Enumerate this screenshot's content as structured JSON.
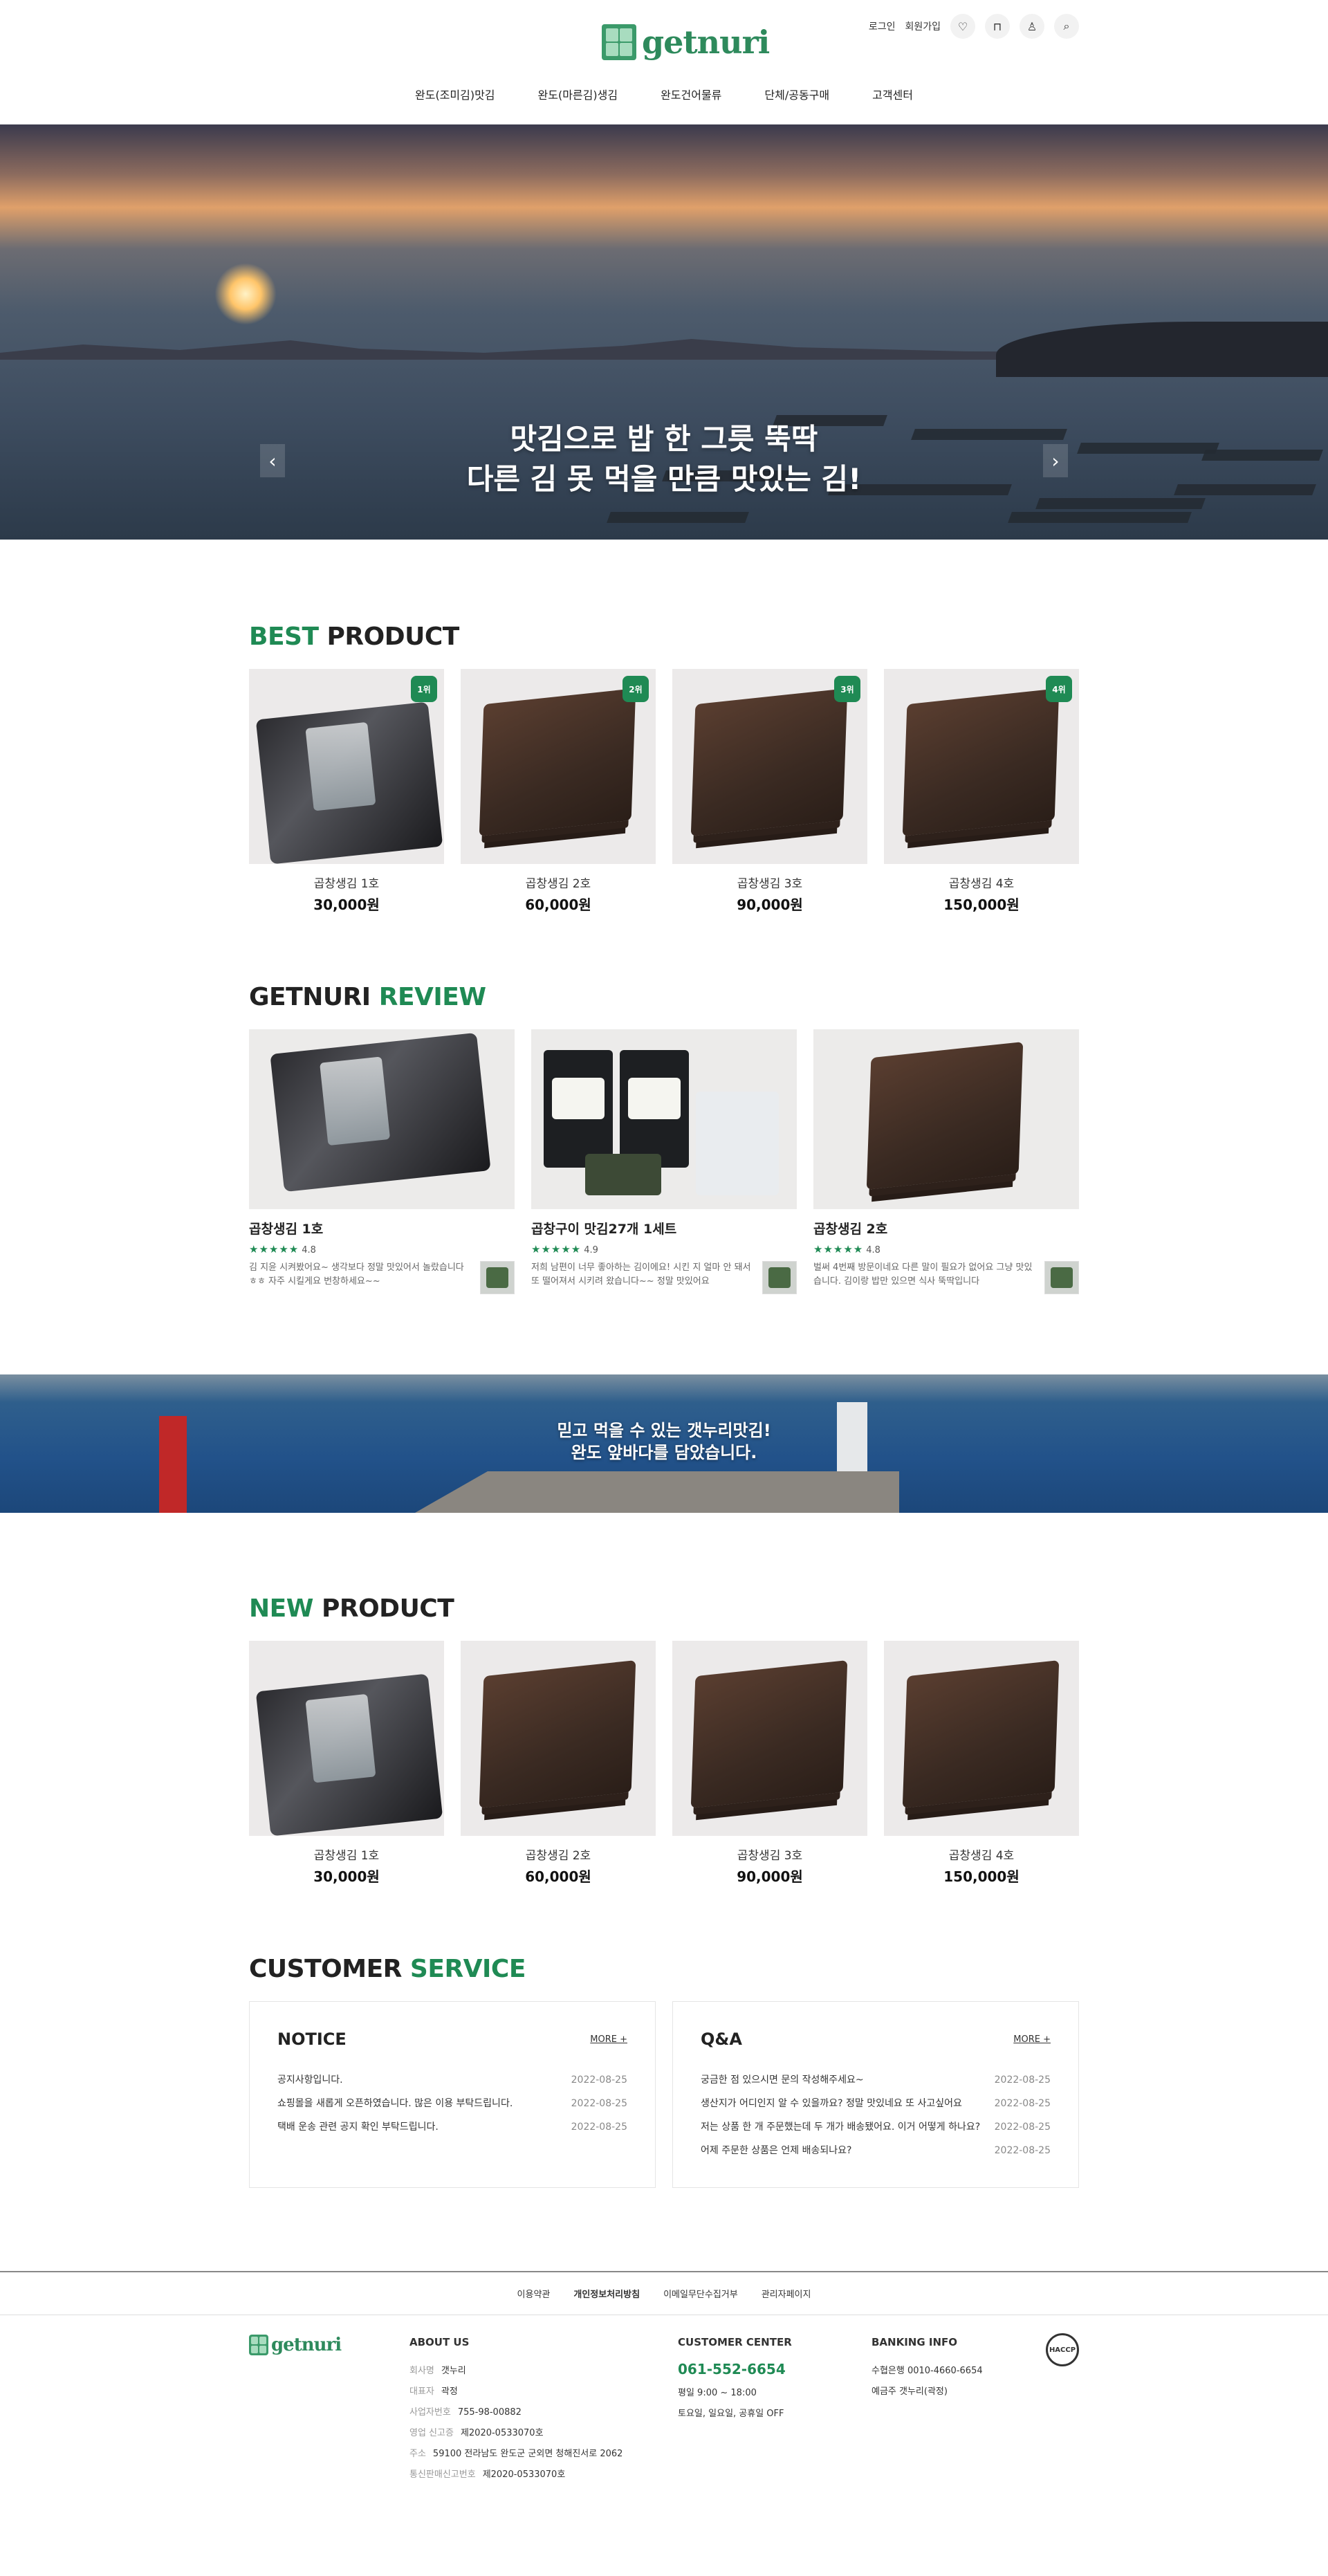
{
  "header": {
    "logo_text": "getnuri",
    "util": {
      "login": "로그인",
      "join": "회원가입"
    },
    "nav": [
      "완도(조미김)맛김",
      "완도(마른김)생김",
      "완도건어물류",
      "단체/공동구매",
      "고객센터"
    ]
  },
  "hero": {
    "line1": "맛김으로 밥 한 그릇 뚝딱",
    "line2": "다른 김 못 먹을 만큼 맛있는 김!",
    "prev": "‹",
    "next": "›"
  },
  "best": {
    "title_accent": "BEST",
    "title_rest": " PRODUCT",
    "items": [
      {
        "rank": "1위",
        "name": "곱창생김 1호",
        "price": "30,000원"
      },
      {
        "rank": "2위",
        "name": "곱창생김 2호",
        "price": "60,000원"
      },
      {
        "rank": "3위",
        "name": "곱창생김 3호",
        "price": "90,000원"
      },
      {
        "rank": "4위",
        "name": "곱창생김 4호",
        "price": "150,000원"
      }
    ]
  },
  "review": {
    "title_rest": "GETNURI ",
    "title_accent": "REVIEW",
    "items": [
      {
        "name": "곱창생김 1호",
        "stars": "★★★★★",
        "score": "4.8",
        "text": "김 지윤 시켜봤어요~ 생각보다 정말 맛있어서 놀랐습니다 ㅎㅎ 자주 시킬게요 번창하세요~~"
      },
      {
        "name": "곱창구이 맛김27개 1세트",
        "stars": "★★★★★",
        "score": "4.9",
        "text": "저희 남편이 너무 좋아하는 김이에요! 시킨 지 얼마 안 돼서 또 떨어져서 시키려 왔습니다~~ 정말 맛있어요"
      },
      {
        "name": "곱창생김 2호",
        "stars": "★★★★★",
        "score": "4.8",
        "text": "벌써 4번째 방문이네요 다른 말이 필요가 없어요 그냥 맛있습니다. 김이랑 밥만 있으면 식사 뚝딱입니다"
      }
    ]
  },
  "banner": {
    "line1": "믿고 먹을 수 있는 갯누리맛김!",
    "line2": "완도 앞바다를 담았습니다."
  },
  "new": {
    "title_accent": "NEW",
    "title_rest": " PRODUCT",
    "items": [
      {
        "name": "곱창생김 1호",
        "price": "30,000원"
      },
      {
        "name": "곱창생김 2호",
        "price": "60,000원"
      },
      {
        "name": "곱창생김 3호",
        "price": "90,000원"
      },
      {
        "name": "곱창생김 4호",
        "price": "150,000원"
      }
    ]
  },
  "cs": {
    "title_rest": "CUSTOMER ",
    "title_accent": "SERVICE",
    "notice": {
      "title": "NOTICE",
      "more": "MORE +",
      "rows": [
        {
          "t": "공지사항입니다.",
          "d": "2022-08-25"
        },
        {
          "t": "쇼핑몰을 새롭게 오픈하였습니다. 많은 이용 부탁드립니다.",
          "d": "2022-08-25"
        },
        {
          "t": "택배 운송 관련 공지 확인 부탁드립니다.",
          "d": "2022-08-25"
        }
      ]
    },
    "qna": {
      "title": "Q&A",
      "more": "MORE +",
      "rows": [
        {
          "t": "궁금한 점 있으시면 문의 작성해주세요~",
          "d": "2022-08-25"
        },
        {
          "t": "생산지가 어디인지 알 수 있을까요? 정말 맛있네요 또 사고싶어요",
          "d": "2022-08-25"
        },
        {
          "t": "저는 상품 한 개 주문했는데 두 개가 배송됐어요. 이거 어떻게 하나요?",
          "d": "2022-08-25"
        },
        {
          "t": "어제 주문한 상품은 언제 배송되나요?",
          "d": "2022-08-25"
        }
      ]
    }
  },
  "footer": {
    "links": [
      "이용약관",
      "개인정보처리방침",
      "이메일무단수집거부",
      "관리자페이지"
    ],
    "logo_text": "getnuri",
    "about": {
      "title": "ABOUT US",
      "rows": [
        {
          "k": "회사명",
          "v": "갯누리"
        },
        {
          "k": "대표자",
          "v": "곽정"
        },
        {
          "k": "사업자번호",
          "v": "755-98-00882"
        },
        {
          "k": "영업 신고증",
          "v": "제2020-0533070호"
        },
        {
          "k": "주소",
          "v": "59100 전라남도 완도군 군외면 청해진서로 2062"
        },
        {
          "k": "통신판매신고번호",
          "v": "제2020-0533070호"
        }
      ]
    },
    "center": {
      "title": "CUSTOMER CENTER",
      "phone": "061-552-6654",
      "hours": "평일 9:00 ~ 18:00",
      "off": "토요일, 일요일, 공휴일 OFF"
    },
    "bank": {
      "title": "BANKING INFO",
      "account": "수협은행 0010-4660-6654",
      "holder": "예금주 갯누리(곽정)"
    },
    "badge": "HACCP"
  }
}
